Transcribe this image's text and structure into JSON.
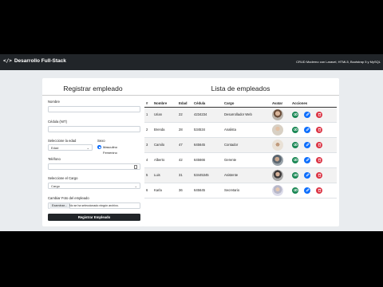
{
  "navbar": {
    "brand_icon": "</>",
    "brand": "Desarrollo Full-Stack",
    "subtitle": "CRUD Moderno con Laravel, HTML5, Bootstrap 5 y MySQL"
  },
  "form": {
    "title": "Registrar empleado",
    "nombre_label": "Nombre",
    "cedula_label": "Cédula (NIT)",
    "edad_label": "Seleccione la edad",
    "edad_value": "Edad",
    "sexo_label": "Sexo",
    "sexo_options": [
      "Masculino",
      "Femenino"
    ],
    "telefono_label": "Teléfono",
    "cargo_label": "Seleccione el Cargo",
    "cargo_value": "Cargo",
    "foto_label": "Cambiar Foto del empleado",
    "file_button": "Examinar...",
    "file_text": "No se ha seleccionado ningún archivo.",
    "submit_label": "Registrar Empleado"
  },
  "list": {
    "title": "Lista de empleados",
    "columns": [
      "#",
      "Nombre",
      "Edad",
      "Cédula",
      "Cargo",
      "Avatar",
      "Acciones"
    ],
    "rows": [
      {
        "id": "1",
        "nombre": "Urian",
        "edad": "22",
        "cedula": "4234234",
        "cargo": "Desarrollador Web"
      },
      {
        "id": "2",
        "nombre": "Brenda",
        "edad": "28",
        "cedula": "534534",
        "cargo": "Analista"
      },
      {
        "id": "3",
        "nombre": "Camilo",
        "edad": "47",
        "cedula": "645645",
        "cargo": "Contador"
      },
      {
        "id": "4",
        "nombre": "Alberto",
        "edad": "42",
        "cedula": "645666",
        "cargo": "Gerente"
      },
      {
        "id": "5",
        "nombre": "Luis",
        "edad": "31",
        "cedula": "53445345",
        "cargo": "Asistente"
      },
      {
        "id": "6",
        "nombre": "Karla",
        "edad": "36",
        "cedula": "645645",
        "cargo": "Secretario"
      }
    ]
  },
  "colors": {
    "navbar": "#212529",
    "view_button": "#198754",
    "edit_button": "#0d6efd",
    "delete_button": "#dc3545"
  },
  "icons": [
    "code-icon",
    "calendar-icon",
    "chevron-down-icon",
    "eye-icon",
    "pencil-icon",
    "trash-icon",
    "avatar-photo"
  ]
}
